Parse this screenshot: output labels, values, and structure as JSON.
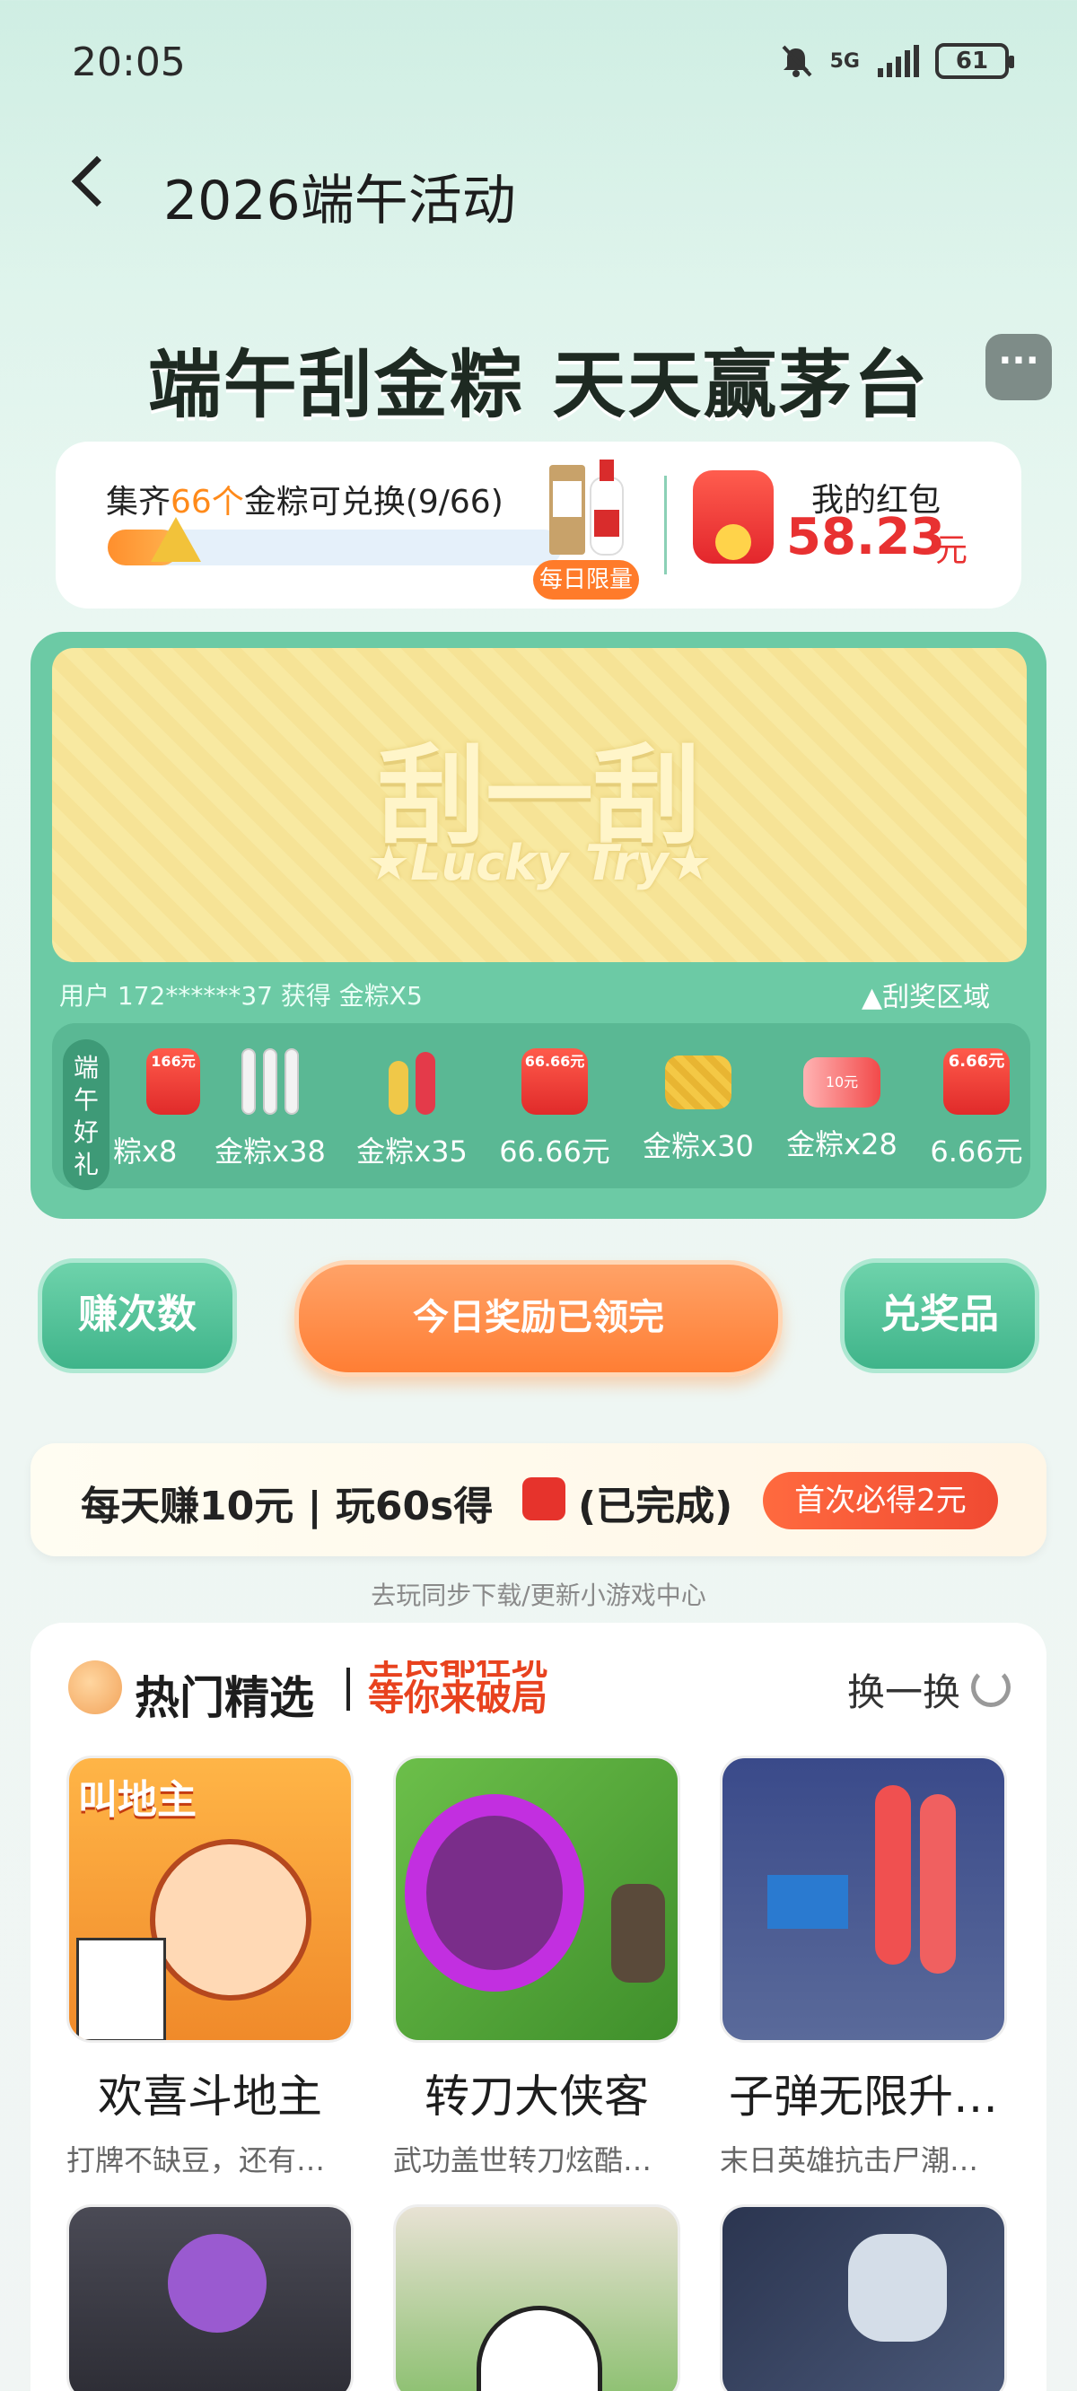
{
  "status_bar": {
    "time": "20:05",
    "network": "5G",
    "battery": "61"
  },
  "header": {
    "title": "2026端午活动"
  },
  "banner": {
    "title": "端午刮金粽 天天赢茅台",
    "more_label": "···"
  },
  "progress": {
    "prefix": "集齐",
    "highlight": "66个",
    "suffix": "金粽可兑换(9/66)",
    "collected": 9,
    "total": 66,
    "daily_badge": "每日限量"
  },
  "wallet": {
    "label": "我的红包",
    "amount": "58.23",
    "unit": "元"
  },
  "scratch": {
    "title": "刮一刮",
    "subtitle": "★Lucky Try★",
    "winner_text": "用户 172******37 获得 金粽X5",
    "zone_label": "▲刮奖区域"
  },
  "prizes": {
    "side_label": "端午好礼",
    "items": [
      {
        "label": "粽x8",
        "icon_text": "166元"
      },
      {
        "label": "金粽x38",
        "icon_text": ""
      },
      {
        "label": "金粽x35",
        "icon_text": ""
      },
      {
        "label": "66.66元",
        "icon_text": "66.66元"
      },
      {
        "label": "金粽x30",
        "icon_text": ""
      },
      {
        "label": "金粽x28",
        "icon_text": "10元"
      },
      {
        "label": "6.66元",
        "icon_text": "6.66元"
      }
    ]
  },
  "actions": {
    "earn_label": "赚次数",
    "today_label": "今日奖励已领完",
    "redeem_label": "兑奖品"
  },
  "task": {
    "text": "每天赚10元 | 玩60s得",
    "status": "(已完成)",
    "badge": "首次必得2元",
    "hint": "去玩同步下载/更新小游戏中心"
  },
  "games": {
    "section_title": "热门精选",
    "slogan_line1": "全民都在玩",
    "slogan_line2": "等你来破局",
    "refresh_label": "换一换",
    "items": [
      {
        "name": "欢喜斗地主",
        "desc": "打牌不缺豆，还有…",
        "badge": "叫地主"
      },
      {
        "name": "转刀大侠客",
        "desc": "武功盖世转刀炫酷…"
      },
      {
        "name": "子弹无限升…",
        "desc": "末日英雄抗击尸潮…"
      }
    ]
  },
  "colors": {
    "accent_green": "#6ccaa5",
    "accent_orange": "#ff7e34",
    "price_red": "#e83131"
  }
}
